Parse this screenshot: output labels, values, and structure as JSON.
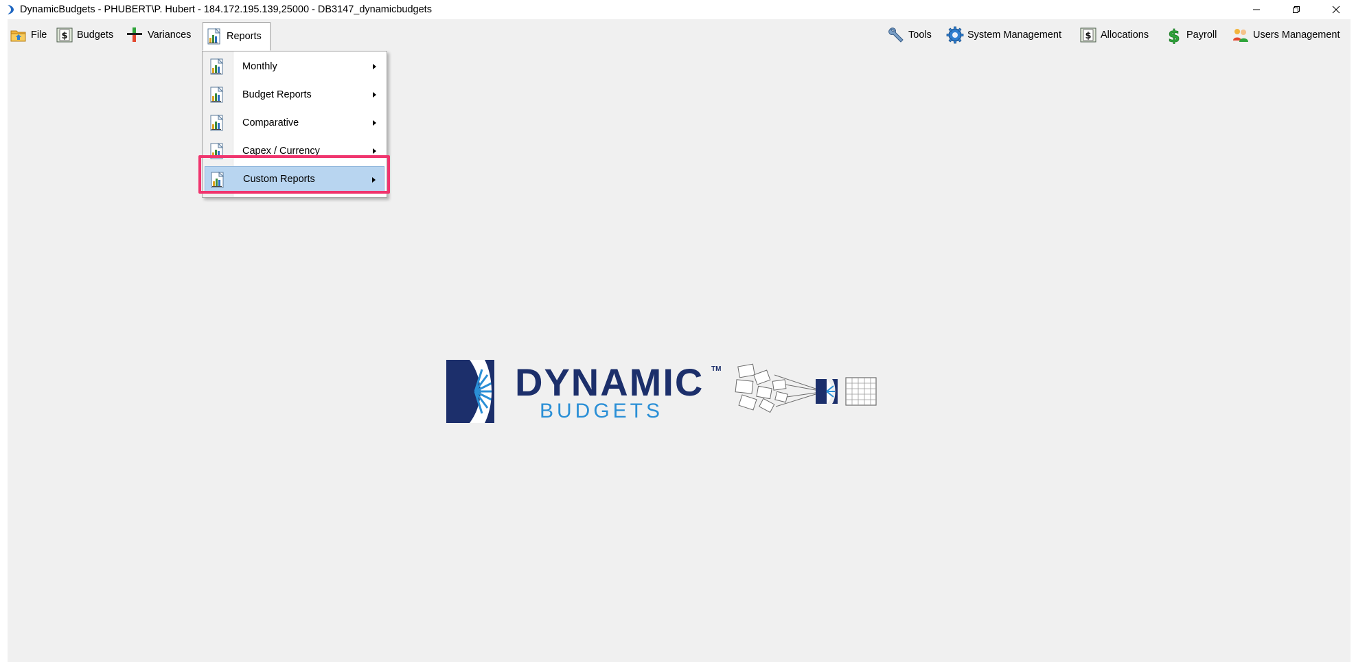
{
  "window": {
    "title": "DynamicBudgets - PHUBERT\\P. Hubert - 184.172.195.139,25000 - DB3147_dynamicbudgets",
    "controls": [
      "minimize-icon",
      "restore-icon",
      "close-icon"
    ]
  },
  "menubar": {
    "left": [
      {
        "label": "File",
        "icon": "folder-icon"
      },
      {
        "label": "Budgets",
        "icon": "dollar-sheet-icon"
      },
      {
        "label": "Variances",
        "icon": "plus-minus-icon"
      },
      {
        "label": "Reports",
        "icon": "report-chart-icon",
        "active": true
      }
    ],
    "right": [
      {
        "label": "Tools",
        "icon": "wrench-icon"
      },
      {
        "label": "System Management",
        "icon": "gear-icon"
      },
      {
        "label": "Allocations",
        "icon": "dollar-sheet-icon"
      },
      {
        "label": "Payroll",
        "icon": "dollar-sign-icon"
      },
      {
        "label": "Users Management",
        "icon": "users-icon"
      }
    ]
  },
  "reports_menu": {
    "items": [
      {
        "label": "Monthly",
        "icon": "report-chart-icon",
        "has_submenu": true
      },
      {
        "label": "Budget Reports",
        "icon": "report-chart-icon",
        "has_submenu": true
      },
      {
        "label": "Comparative",
        "icon": "report-chart-icon",
        "has_submenu": true
      },
      {
        "label": "Capex / Currency",
        "icon": "report-chart-icon",
        "has_submenu": true
      },
      {
        "label": "Custom Reports",
        "icon": "report-chart-icon",
        "has_submenu": true,
        "hovered": true
      }
    ]
  },
  "logo": {
    "line1": "DYNAMIC",
    "trademark": "TM",
    "line2": "BUDGETS"
  },
  "colors": {
    "highlight": "#f0356e",
    "menu_hover": "#b8d5f0",
    "logo_navy": "#1c2f6b",
    "logo_blue": "#2a8fd6"
  }
}
